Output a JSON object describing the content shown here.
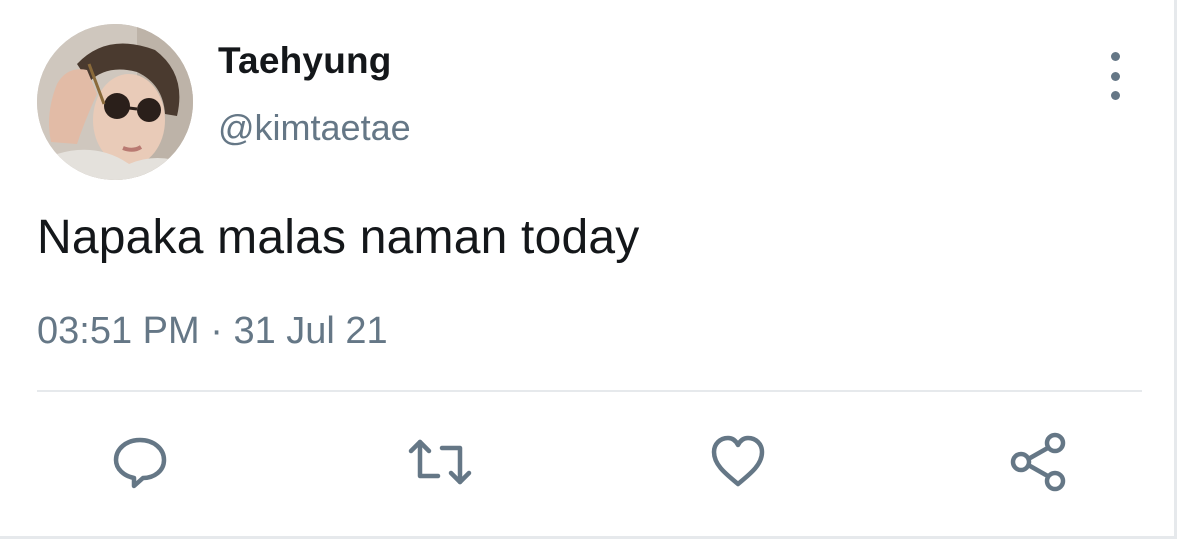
{
  "tweet": {
    "author": {
      "display_name": "Taehyung",
      "handle": "@kimtaetae"
    },
    "text": "Napaka malas naman today",
    "time": "03:51 PM",
    "separator": "·",
    "date": "31 Jul 21"
  },
  "actions": [
    {
      "name": "reply",
      "icon": "speech-bubble-icon"
    },
    {
      "name": "retweet",
      "icon": "retweet-icon"
    },
    {
      "name": "like",
      "icon": "heart-icon"
    },
    {
      "name": "share",
      "icon": "share-icon"
    }
  ],
  "colors": {
    "text_primary": "#14171a",
    "text_secondary": "#657786",
    "divider": "#e6e9ec",
    "background": "#ffffff"
  }
}
